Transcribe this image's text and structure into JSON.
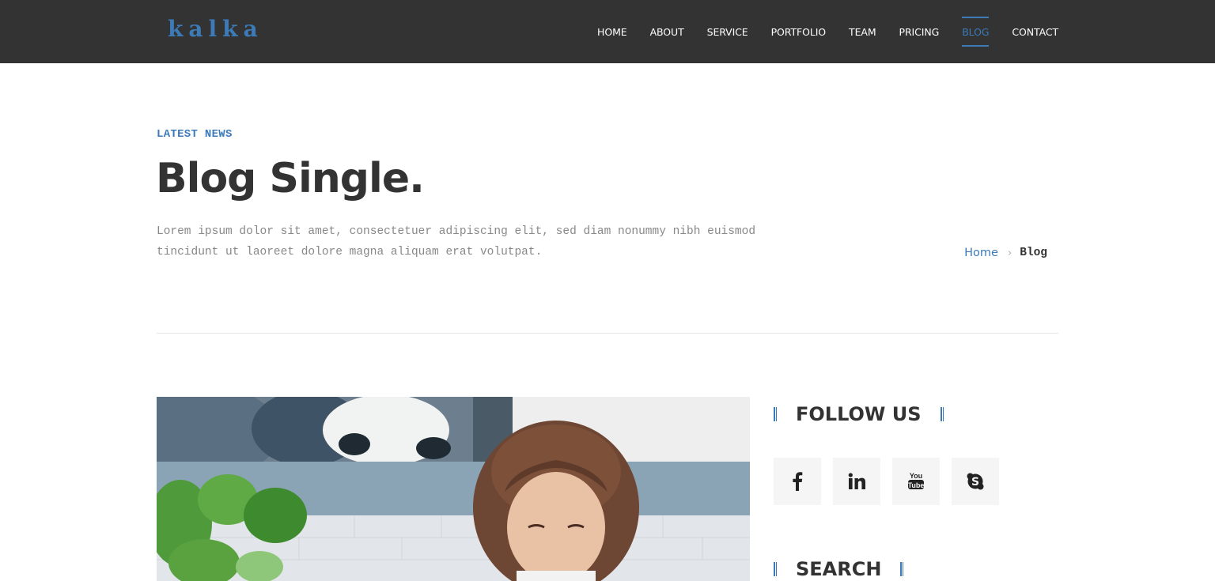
{
  "brand": {
    "logo_text": "kalka",
    "accent_color": "#3c7ab8",
    "header_bg": "#333333"
  },
  "nav": {
    "items": [
      {
        "label": "HOME"
      },
      {
        "label": "ABOUT"
      },
      {
        "label": "SERVICE"
      },
      {
        "label": "PORTFOLIO"
      },
      {
        "label": "TEAM"
      },
      {
        "label": "PRICING"
      },
      {
        "label": "BLOG",
        "active": true
      },
      {
        "label": "CONTACT"
      }
    ]
  },
  "hero": {
    "eyebrow": "LATEST NEWS",
    "title": "Blog Single.",
    "intro_line1": "Lorem ipsum dolor sit amet, consectetuer adipiscing elit, sed diam nonummy nibh euismod",
    "intro_line2": "tincidunt ut laoreet dolore magna aliquam erat volutpat."
  },
  "breadcrumb": {
    "home": "Home",
    "separator_icon": "chevron-right-icon",
    "current": "Blog"
  },
  "sidebar": {
    "follow_title": "FOLLOW US",
    "social": [
      {
        "name": "facebook-icon"
      },
      {
        "name": "linkedin-icon"
      },
      {
        "name": "youtube-icon"
      },
      {
        "name": "skype-icon"
      }
    ],
    "search_title": "SEARCH"
  }
}
